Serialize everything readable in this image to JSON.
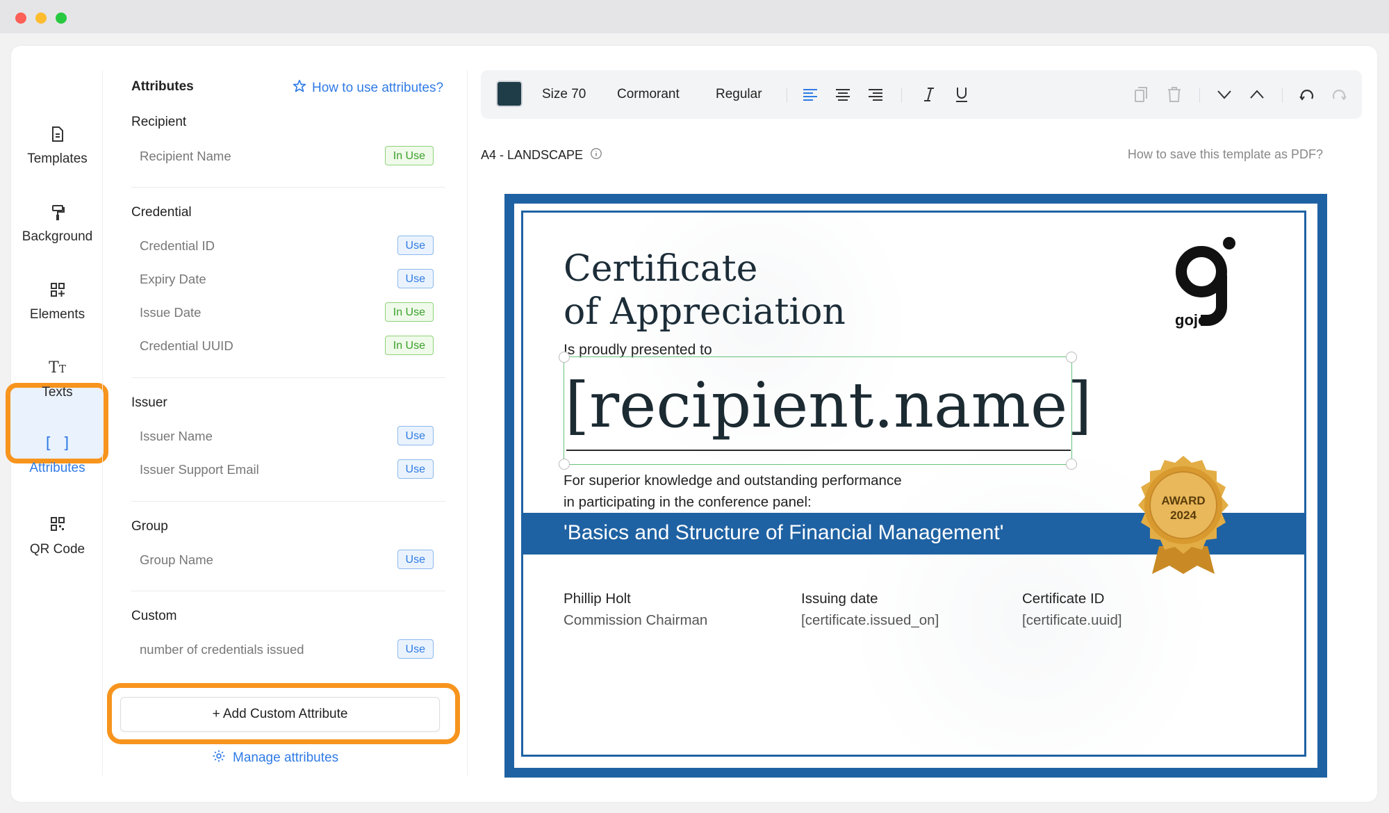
{
  "nav": {
    "items": [
      {
        "label": "Templates",
        "icon": "file-icon"
      },
      {
        "label": "Background",
        "icon": "paint-roller-icon"
      },
      {
        "label": "Elements",
        "icon": "elements-icon"
      },
      {
        "label": "Texts",
        "icon": "text-icon"
      },
      {
        "label": "Attributes",
        "icon": "brackets-icon"
      },
      {
        "label": "QR Code",
        "icon": "qr-code-icon"
      }
    ],
    "active": "Attributes"
  },
  "panel": {
    "title": "Attributes",
    "help_link": "How to use attributes?",
    "sections": {
      "recipient": {
        "title": "Recipient",
        "items": [
          {
            "label": "Recipient Name",
            "status": "In Use"
          }
        ]
      },
      "credential": {
        "title": "Credential",
        "items": [
          {
            "label": "Credential ID",
            "status": "Use"
          },
          {
            "label": "Expiry Date",
            "status": "Use"
          },
          {
            "label": "Issue Date",
            "status": "In Use"
          },
          {
            "label": "Credential UUID",
            "status": "In Use"
          }
        ]
      },
      "issuer": {
        "title": "Issuer",
        "items": [
          {
            "label": "Issuer Name",
            "status": "Use"
          },
          {
            "label": "Issuer Support Email",
            "status": "Use"
          }
        ]
      },
      "group": {
        "title": "Group",
        "items": [
          {
            "label": "Group Name",
            "status": "Use"
          }
        ]
      },
      "custom": {
        "title": "Custom",
        "items": [
          {
            "label": "number of credentials issued",
            "status": "Use"
          }
        ]
      }
    },
    "add_button": "+ Add Custom Attribute",
    "manage_link": "Manage attributes"
  },
  "toolbar": {
    "color": "#1f3d48",
    "size": "Size 70",
    "font": "Cormorant",
    "weight": "Regular"
  },
  "canvas": {
    "page_size": "A4 - LANDSCAPE",
    "pdf_help": "How to save this template as PDF?"
  },
  "certificate": {
    "title_line1": "Certificate",
    "title_line2": "of Appreciation",
    "logo_text": "gojo",
    "presented": "Is proudly presented to",
    "recipient": "[recipient.name]",
    "desc_line1": "For superior knowledge and outstanding performance",
    "desc_line2": "in participating in the conference panel:",
    "banner": "'Basics and Structure of Financial Management'",
    "seal_line1": "AWARD",
    "seal_line2": "2024",
    "footer": [
      {
        "heading": "Phillip Holt",
        "sub": "Commission Chairman"
      },
      {
        "heading": "Issuing date",
        "sub": "[certificate.issued_on]"
      },
      {
        "heading": "Certificate ID",
        "sub": "[certificate.uuid]"
      }
    ],
    "colors": {
      "frame": "#1f62a3",
      "seal": "#e0a93a"
    }
  }
}
